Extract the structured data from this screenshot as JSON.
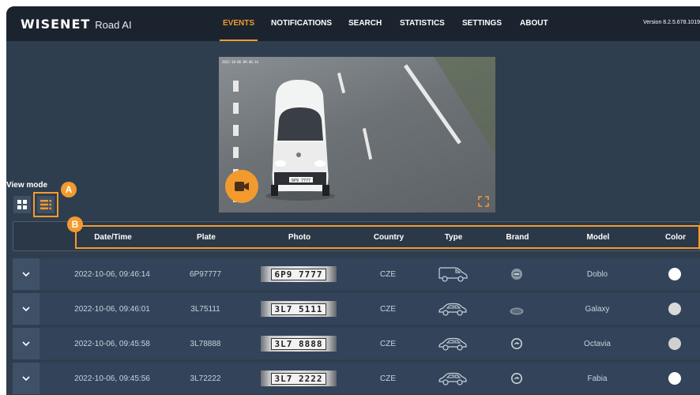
{
  "app": {
    "logo": "WISENET",
    "product": "Road AI",
    "version": "Version 8.2.5.678.1019"
  },
  "nav": [
    {
      "id": "events",
      "label": "EVENTS",
      "active": true
    },
    {
      "id": "notifications",
      "label": "NOTIFICATIONS"
    },
    {
      "id": "search",
      "label": "SEARCH"
    },
    {
      "id": "statistics",
      "label": "STATISTICS"
    },
    {
      "id": "settings",
      "label": "SETTINGS"
    },
    {
      "id": "about",
      "label": "ABOUT"
    }
  ],
  "preview": {
    "timestamp": "2022-10-06 09:46:14",
    "van_plate": "6P9 7777"
  },
  "view_mode": {
    "label": "View mode"
  },
  "markers": {
    "a": "A",
    "b": "B"
  },
  "table": {
    "columns": [
      "Date/Time",
      "Plate",
      "Photo",
      "Country",
      "Type",
      "Brand",
      "Model",
      "Color"
    ],
    "rows": [
      {
        "datetime": "2022-10-06, 09:46:14",
        "plate": "6P97777",
        "photo_text": "6P9 7777",
        "country": "CZE",
        "type_icon": "van-icon",
        "brand_icon": "fiat-logo-icon",
        "model": "Doblo",
        "color": "#ffffff"
      },
      {
        "datetime": "2022-10-06, 09:46:01",
        "plate": "3L75111",
        "photo_text": "3L7 5111",
        "country": "CZE",
        "type_icon": "car-icon",
        "brand_icon": "ford-logo-icon",
        "model": "Galaxy",
        "color": "#d9d9d9"
      },
      {
        "datetime": "2022-10-06, 09:45:58",
        "plate": "3L78888",
        "photo_text": "3L7 8888",
        "country": "CZE",
        "type_icon": "car-icon",
        "brand_icon": "skoda-logo-icon",
        "model": "Octavia",
        "color": "#d0d0d0"
      },
      {
        "datetime": "2022-10-06, 09:45:56",
        "plate": "3L72222",
        "photo_text": "3L7 2222",
        "country": "CZE",
        "type_icon": "car-icon",
        "brand_icon": "skoda-logo-icon",
        "model": "Fabia",
        "color": "#ffffff"
      }
    ]
  },
  "colors": {
    "accent": "#f39a2f",
    "topbar": "#1b242e",
    "background": "#2f3e4e"
  }
}
